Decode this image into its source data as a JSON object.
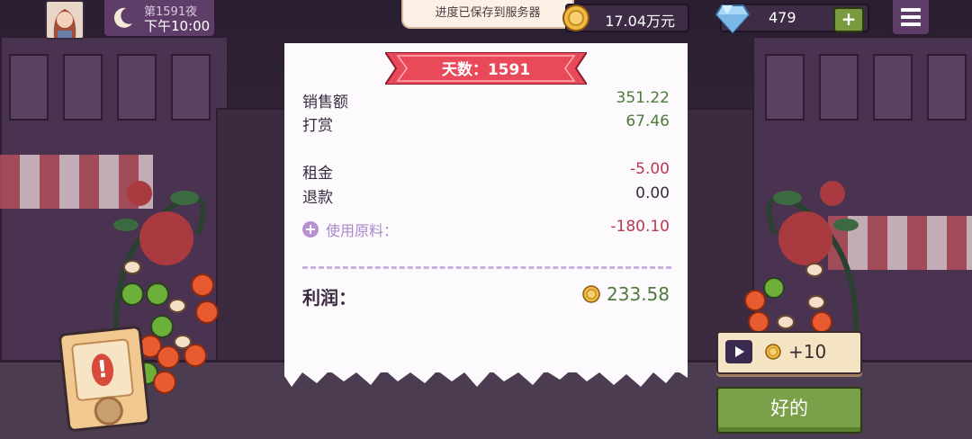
{
  "hud": {
    "night_label": "第1591夜",
    "time_label": "下午10:00",
    "toast": "进度已保存到服务器",
    "money": "17.04万元",
    "gems": "479",
    "gem_add": "+"
  },
  "receipt": {
    "day_banner": "天数：1591",
    "rows": [
      {
        "label": "销售额",
        "value": "351.22"
      },
      {
        "label": "打赏",
        "value": "67.46"
      },
      {
        "label": "租金",
        "value": "-5.00"
      },
      {
        "label": "退款",
        "value": "0.00"
      }
    ],
    "ingredients_label": "使用原料：",
    "ingredients_plus": "+",
    "ingredients_value": "-180.10",
    "profit_label": "利润：",
    "profit_value": "233.58"
  },
  "buttons": {
    "ad_reward": "+10",
    "ok": "好的"
  },
  "alert": {
    "mark": "!"
  },
  "colors": {
    "positive": "#4e7a3a",
    "negative": "#b83a50",
    "banner": "#e84a5a",
    "ok_button": "#7aa04a"
  },
  "icons": [
    "moon-icon",
    "coin-icon",
    "diamond-icon",
    "plus-icon",
    "menu-icon",
    "play-icon",
    "alert-icon"
  ]
}
